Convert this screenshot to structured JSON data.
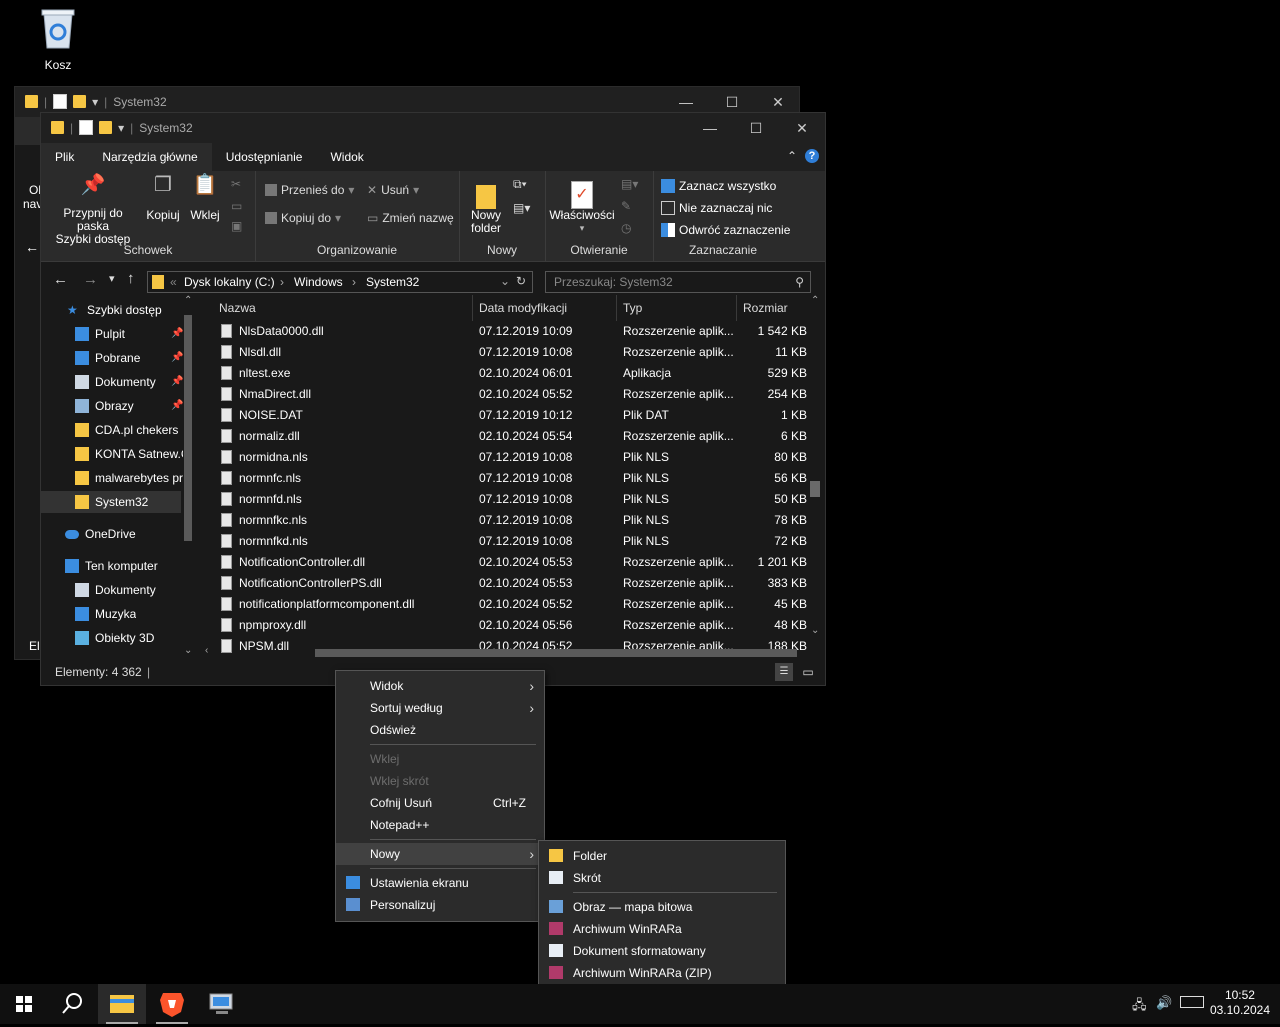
{
  "desktop": {
    "recycle_bin_label": "Kosz"
  },
  "back_window": {
    "title": "System32",
    "partial_labels": [
      "Ol",
      "nav",
      "El"
    ]
  },
  "window": {
    "title": "System32",
    "tabs": [
      "Plik",
      "Narzędzia główne",
      "Udostępnianie",
      "Widok"
    ],
    "active_tab": "Narzędzia główne",
    "ribbon": {
      "clipboard": {
        "name": "Schowek",
        "pin": "Przypnij do paska\nSzybki dostęp",
        "copy": "Kopiuj",
        "paste": "Wklej"
      },
      "organize": {
        "name": "Organizowanie",
        "move_to": "Przenieś do",
        "copy_to": "Kopiuj do",
        "delete": "Usuń",
        "rename": "Zmień nazwę"
      },
      "new": {
        "name": "Nowy",
        "new_folder": "Nowy\nfolder"
      },
      "open": {
        "name": "Otwieranie",
        "properties": "Właściwości"
      },
      "select": {
        "name": "Zaznaczanie",
        "select_all": "Zaznacz wszystko",
        "select_none": "Nie zaznaczaj nic",
        "invert": "Odwróć zaznaczenie"
      }
    },
    "address": {
      "crumbs": [
        "Dysk lokalny (C:)",
        "Windows",
        "System32"
      ],
      "search_placeholder": "Przeszukaj: System32"
    },
    "nav": [
      {
        "label": "Szybki dostęp",
        "icon": "star-icon",
        "color": "#3b8de0"
      },
      {
        "label": "Pulpit",
        "icon": "desktop-icon",
        "color": "#3b8de0",
        "pinned": true
      },
      {
        "label": "Pobrane",
        "icon": "download-icon",
        "color": "#3b8de0",
        "pinned": true
      },
      {
        "label": "Dokumenty",
        "icon": "document-icon",
        "color": "#cfd8e3",
        "pinned": true
      },
      {
        "label": "Obrazy",
        "icon": "pictures-icon",
        "color": "#8fb4d8",
        "pinned": true
      },
      {
        "label": "CDA.pl chekers",
        "icon": "folder-icon",
        "color": "#f6c644"
      },
      {
        "label": "KONTA Satnew.C",
        "icon": "folder-icon",
        "color": "#f6c644"
      },
      {
        "label": "malwarebytes pr",
        "icon": "folder-icon",
        "color": "#f6c644"
      },
      {
        "label": "System32",
        "icon": "folder-icon",
        "color": "#f6c644",
        "selected": true
      },
      {
        "label": "OneDrive",
        "icon": "cloud-icon",
        "color": "#3b8de0"
      },
      {
        "label": "Ten komputer",
        "icon": "computer-icon",
        "color": "#3b8de0"
      },
      {
        "label": "Dokumenty",
        "icon": "document-icon",
        "color": "#cfd8e3"
      },
      {
        "label": "Muzyka",
        "icon": "music-icon",
        "color": "#3b8de0"
      },
      {
        "label": "Obiekty 3D",
        "icon": "cube-icon",
        "color": "#5ab0e0"
      }
    ],
    "columns": [
      "Nazwa",
      "Data modyfikacji",
      "Typ",
      "Rozmiar"
    ],
    "files": [
      [
        "NlsData0000.dll",
        "07.12.2019 10:09",
        "Rozszerzenie aplik...",
        "1 542 KB"
      ],
      [
        "Nlsdl.dll",
        "07.12.2019 10:08",
        "Rozszerzenie aplik...",
        "11 KB"
      ],
      [
        "nltest.exe",
        "02.10.2024 06:01",
        "Aplikacja",
        "529 KB"
      ],
      [
        "NmaDirect.dll",
        "02.10.2024 05:52",
        "Rozszerzenie aplik...",
        "254 KB"
      ],
      [
        "NOISE.DAT",
        "07.12.2019 10:12",
        "Plik DAT",
        "1 KB"
      ],
      [
        "normaliz.dll",
        "02.10.2024 05:54",
        "Rozszerzenie aplik...",
        "6 KB"
      ],
      [
        "normidna.nls",
        "07.12.2019 10:08",
        "Plik NLS",
        "80 KB"
      ],
      [
        "normnfc.nls",
        "07.12.2019 10:08",
        "Plik NLS",
        "56 KB"
      ],
      [
        "normnfd.nls",
        "07.12.2019 10:08",
        "Plik NLS",
        "50 KB"
      ],
      [
        "normnfkc.nls",
        "07.12.2019 10:08",
        "Plik NLS",
        "78 KB"
      ],
      [
        "normnfkd.nls",
        "07.12.2019 10:08",
        "Plik NLS",
        "72 KB"
      ],
      [
        "NotificationController.dll",
        "02.10.2024 05:53",
        "Rozszerzenie aplik...",
        "1 201 KB"
      ],
      [
        "NotificationControllerPS.dll",
        "02.10.2024 05:53",
        "Rozszerzenie aplik...",
        "383 KB"
      ],
      [
        "notificationplatformcomponent.dll",
        "02.10.2024 05:52",
        "Rozszerzenie aplik...",
        "45 KB"
      ],
      [
        "npmproxy.dll",
        "02.10.2024 05:56",
        "Rozszerzenie aplik...",
        "48 KB"
      ],
      [
        "NPSM.dll",
        "02.10.2024 05:52",
        "Rozszerzenie aplik...",
        "188 KB"
      ]
    ],
    "status": "Elementy: 4 362"
  },
  "context_menu": {
    "items": [
      {
        "label": "Widok",
        "submenu": true
      },
      {
        "label": "Sortuj według",
        "submenu": true
      },
      {
        "label": "Odśwież"
      },
      {
        "sep": true
      },
      {
        "label": "Wklej",
        "disabled": true
      },
      {
        "label": "Wklej skrót",
        "disabled": true
      },
      {
        "label": "Cofnij Usuń",
        "shortcut": "Ctrl+Z"
      },
      {
        "label": "Notepad++"
      },
      {
        "sep": true
      },
      {
        "label": "Nowy",
        "submenu": true,
        "highlight": true
      },
      {
        "sep": true
      },
      {
        "label": "Ustawienia ekranu",
        "icon": "display-icon"
      },
      {
        "label": "Personalizuj",
        "icon": "personalize-icon"
      }
    ]
  },
  "submenu_new": {
    "items": [
      {
        "label": "Folder",
        "icon": "folder-icon"
      },
      {
        "label": "Skrót",
        "icon": "shortcut-icon"
      },
      {
        "sep": true
      },
      {
        "label": "Obraz — mapa bitowa",
        "icon": "bitmap-icon"
      },
      {
        "label": "Archiwum WinRARa",
        "icon": "winrar-icon"
      },
      {
        "label": "Dokument sformatowany",
        "icon": "rtf-icon"
      },
      {
        "label": "Archiwum WinRARa (ZIP)",
        "icon": "winrar-zip-icon"
      }
    ]
  },
  "taskbar": {
    "time": "10:52",
    "date": "03.10.2024"
  },
  "colors": {
    "accent": "#3b8de0",
    "folder": "#f6c644",
    "brave": "#fb542b"
  }
}
